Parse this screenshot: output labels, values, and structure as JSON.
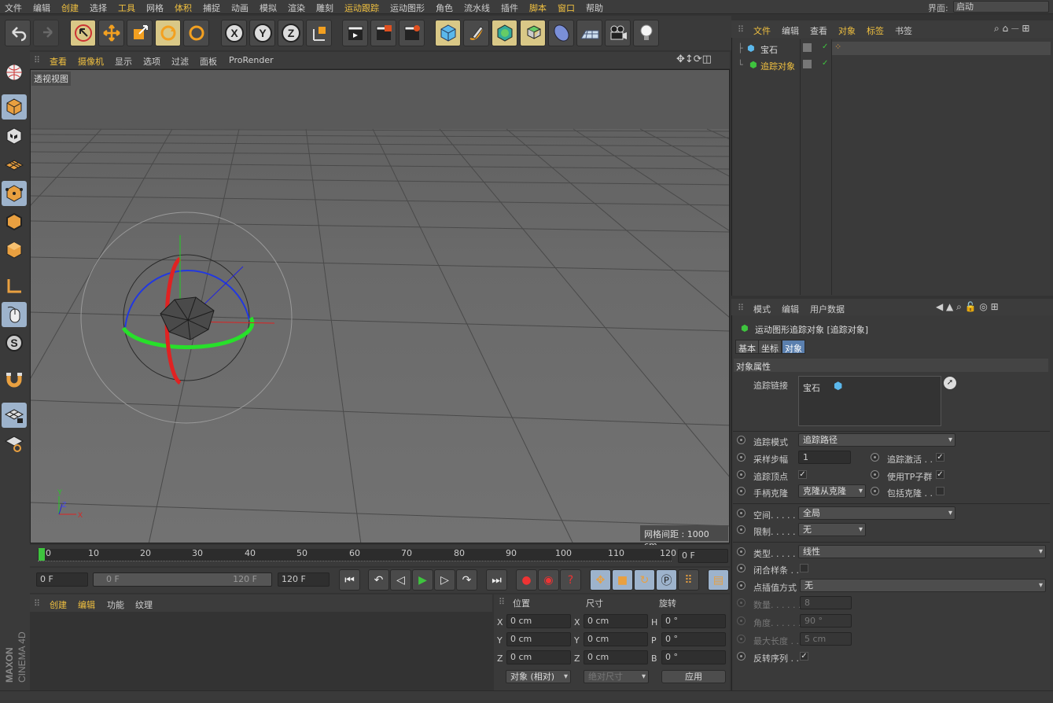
{
  "menu": {
    "items": [
      "文件",
      "编辑",
      "创建",
      "选择",
      "工具",
      "网格",
      "体积",
      "捕捉",
      "动画",
      "模拟",
      "渲染",
      "雕刻",
      "运动跟踪",
      "运动图形",
      "角色",
      "流水线",
      "插件",
      "脚本",
      "窗口",
      "帮助"
    ],
    "interface_label": "界面:",
    "interface_value": "启动"
  },
  "viewport": {
    "menu": [
      "查看",
      "摄像机",
      "显示",
      "选项",
      "过滤",
      "面板",
      "ProRender"
    ],
    "label": "透视视图",
    "grid_spacing": "网格间距 : 1000 cm",
    "axis_labels": {
      "y": "Y",
      "z": "Z",
      "x": "X"
    }
  },
  "timeline": {
    "ticks": [
      "0",
      "10",
      "20",
      "30",
      "40",
      "50",
      "60",
      "70",
      "80",
      "90",
      "100",
      "110",
      "120"
    ],
    "current_frame": "0 F",
    "start": "0 F",
    "range_start": "0 F",
    "range_end": "120 F",
    "end": "120 F"
  },
  "material_panel": {
    "tabs": [
      "创建",
      "编辑",
      "功能",
      "纹理"
    ]
  },
  "coords": {
    "headers": [
      "位置",
      "尺寸",
      "旋转"
    ],
    "rows": [
      {
        "l1": "X",
        "v1": "0 cm",
        "l2": "X",
        "v2": "0 cm",
        "l3": "H",
        "v3": "0 °"
      },
      {
        "l1": "Y",
        "v1": "0 cm",
        "l2": "Y",
        "v2": "0 cm",
        "l3": "P",
        "v3": "0 °"
      },
      {
        "l1": "Z",
        "v1": "0 cm",
        "l2": "Z",
        "v2": "0 cm",
        "l3": "B",
        "v3": "0 °"
      }
    ],
    "mode": "对象 (相对)",
    "size_mode": "绝对尺寸",
    "apply": "应用"
  },
  "object_manager": {
    "menu": [
      "文件",
      "编辑",
      "查看",
      "对象",
      "标签",
      "书签"
    ],
    "objects": [
      {
        "name": "宝石"
      },
      {
        "name": "追踪对象"
      }
    ]
  },
  "attributes": {
    "menu": [
      "模式",
      "编辑",
      "用户数据"
    ],
    "title": "运动图形追踪对象 [追踪对象]",
    "tabs": [
      "基本",
      "坐标",
      "对象"
    ],
    "section": "对象属性",
    "trace_link_label": "追踪链接",
    "trace_link_item": "宝石",
    "trace_mode_label": "追踪模式",
    "trace_mode": "追踪路径",
    "sample_step_label": "采样步幅",
    "sample_step": "1",
    "trace_active_label": "追踪激活 . .",
    "trace_vertices_label": "追踪顶点",
    "use_tp_label": "使用TP子群",
    "handle_clone_label": "手柄克隆",
    "handle_clone": "克隆从克隆",
    "include_clone_label": "包括克隆 . .",
    "space_label": "空间. . . . .",
    "space": "全局",
    "limit_label": "限制. . . . .",
    "limit": "无",
    "type_label": "类型. . . . . .",
    "type": "线性",
    "close_spline_label": "闭合样条 . .",
    "interp_label": "点插值方式",
    "interp": "无",
    "count_label": "数量. . . . . .",
    "count": "8",
    "angle_label": "角度. . . . . .",
    "angle": "90 °",
    "max_len_label": "最大长度 . .",
    "max_len": "5 cm",
    "reverse_label": "反转序列 . ."
  },
  "brand": "MAXON CINEMA 4D"
}
